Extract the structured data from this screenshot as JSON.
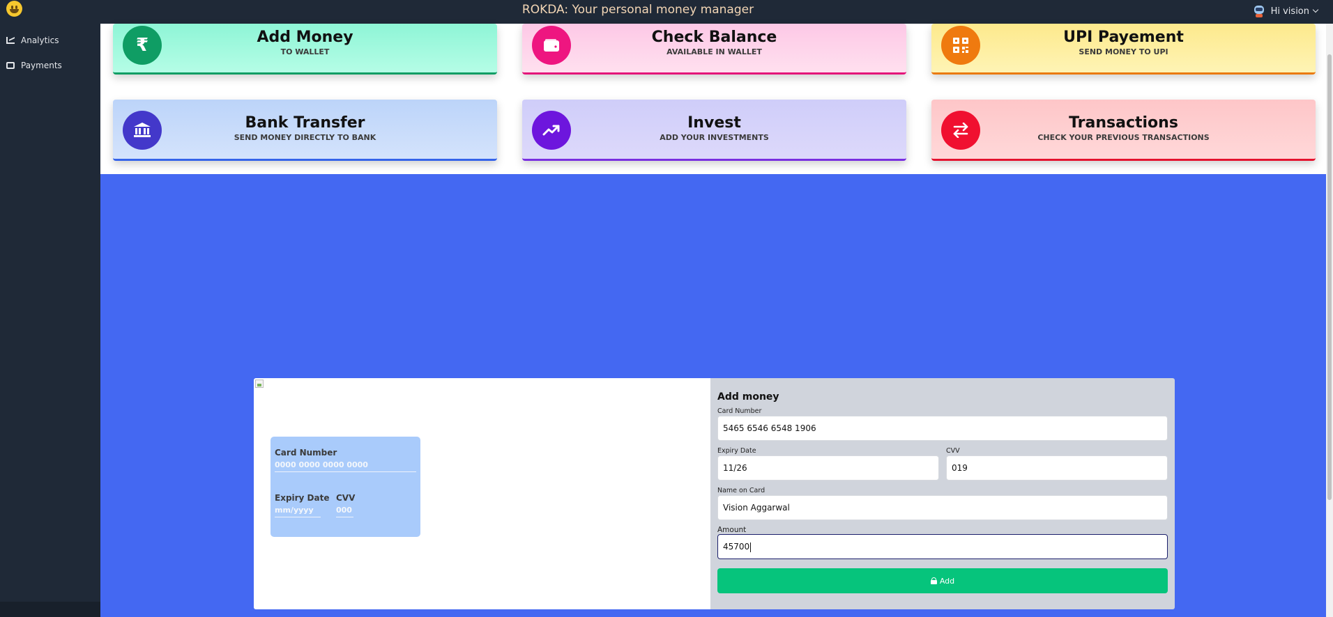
{
  "header": {
    "app_title": "ROKDA: Your personal money manager",
    "user_greeting": "Hi vision"
  },
  "sidebar": {
    "items": [
      {
        "label": "Analytics",
        "icon": "chart-icon"
      },
      {
        "label": "Payments",
        "icon": "wallet-icon"
      }
    ]
  },
  "cards": [
    {
      "title": "Add Money",
      "subtitle": "TO WALLET",
      "icon": "rupee-icon",
      "icon_glyph": "₹",
      "color": "#0f9d64"
    },
    {
      "title": "Check Balance",
      "subtitle": "AVAILABLE IN WALLET",
      "icon": "wallet-icon",
      "color": "#e4157a"
    },
    {
      "title": "UPI Payement",
      "subtitle": "SEND MONEY TO UPI",
      "icon": "qr-code-icon",
      "color": "#ea7a10"
    },
    {
      "title": "Bank Transfer",
      "subtitle": "SEND MONEY DIRECTLY TO BANK",
      "icon": "bank-icon",
      "color": "#3563e9"
    },
    {
      "title": "Invest",
      "subtitle": "ADD YOUR INVESTMENTS",
      "icon": "trending-up-icon",
      "color": "#7a2fe0"
    },
    {
      "title": "Transactions",
      "subtitle": "CHECK YOUR PREVIOUS TRANSACTIONS",
      "icon": "exchange-arrows-icon",
      "color": "#e4132f"
    }
  ],
  "preview_card": {
    "card_number_label": "Card Number",
    "card_number_placeholder": "0000 0000 0000 0000",
    "expiry_label": "Expiry Date",
    "expiry_placeholder": "mm/yyyy",
    "cvv_label": "CVV",
    "cvv_placeholder": "000"
  },
  "form": {
    "title": "Add money",
    "card_number_label": "Card Number",
    "card_number_value": "5465 6546 6548 1906",
    "expiry_label": "Expiry Date",
    "expiry_value": "11/26",
    "cvv_label": "CVV",
    "cvv_value": "019",
    "name_label": "Name on Card",
    "name_value": "Vision Aggarwal",
    "amount_label": "Amount",
    "amount_value": "45700",
    "submit_label": "Add"
  },
  "colors": {
    "background": "#4468f2",
    "topbar": "#1f2937",
    "submit_button": "#06c47c"
  }
}
